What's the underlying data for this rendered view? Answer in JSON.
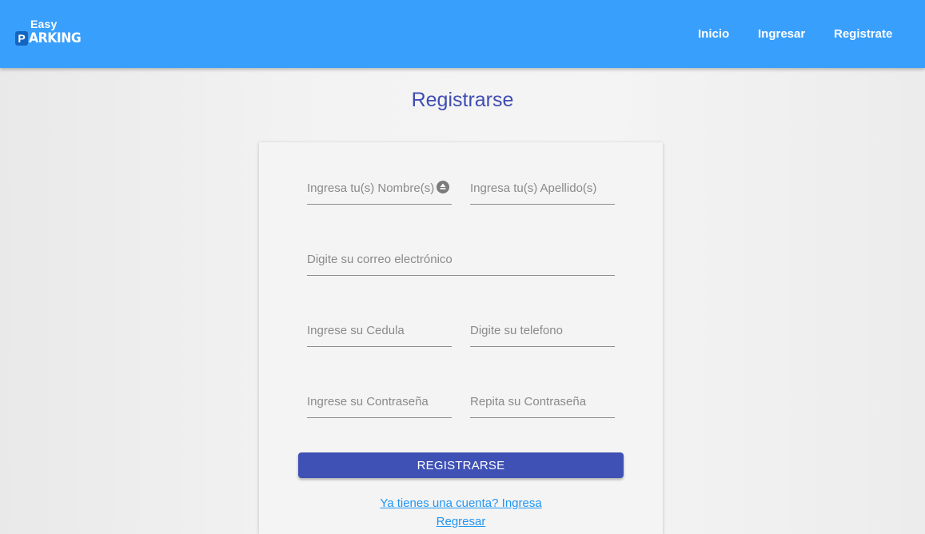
{
  "header": {
    "logo_top": "Easy",
    "logo_p": "P",
    "logo_rest": "ARKING",
    "nav": [
      {
        "label": "Inicio"
      },
      {
        "label": "Ingresar"
      },
      {
        "label": "Registrate"
      }
    ],
    "background": "#399ffd"
  },
  "page": {
    "title": "Registrarse",
    "title_color": "#3f4db3"
  },
  "form": {
    "nombre_placeholder": "Ingresa tu(s) Nombre(s)",
    "apellido_placeholder": "Ingresa tu(s) Apellido(s)",
    "correo_placeholder": "Digite su correo electrónico",
    "cedula_placeholder": "Ingrese su Cedula",
    "telefono_placeholder": "Digite su telefono",
    "password_placeholder": "Ingrese su Contraseña",
    "password_repeat_placeholder": "Repita su Contraseña",
    "submit_label": "REGISTRARSE",
    "submit_color": "#3f51b5",
    "login_link": "Ya tienes una cuenta? Ingresa",
    "back_link": "Regresar",
    "autofill_icon": "contact-card-icon"
  }
}
